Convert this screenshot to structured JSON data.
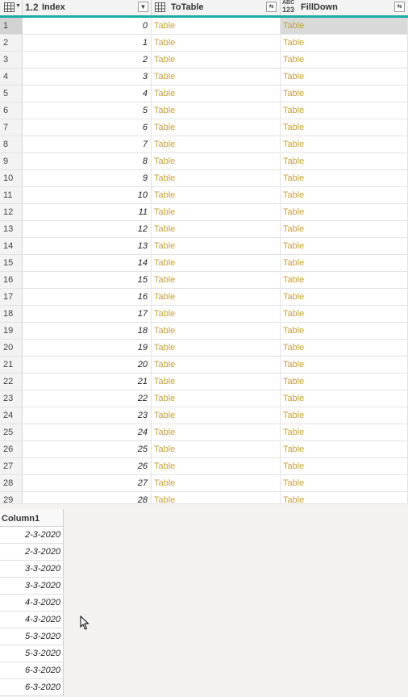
{
  "columns": [
    {
      "type_icon": "table-icon",
      "name": ""
    },
    {
      "type_icon": "1.2",
      "name": "Index"
    },
    {
      "type_icon": "table-icon",
      "name": "ToTable"
    },
    {
      "type_icon": "ABC 123",
      "name": "FillDown"
    }
  ],
  "type_abc": "ABC",
  "type_123": "123",
  "table_link": "Table",
  "row_numbers": [
    "1",
    "2",
    "3",
    "4",
    "5",
    "6",
    "7",
    "8",
    "9",
    "10",
    "11",
    "12",
    "13",
    "14",
    "15",
    "16",
    "17",
    "18",
    "19",
    "20",
    "21",
    "22",
    "23",
    "24",
    "25",
    "26",
    "27",
    "28",
    "29"
  ],
  "index_values": [
    "0",
    "1",
    "2",
    "3",
    "4",
    "5",
    "6",
    "7",
    "8",
    "9",
    "10",
    "11",
    "12",
    "13",
    "14",
    "15",
    "16",
    "17",
    "18",
    "19",
    "20",
    "21",
    "22",
    "23",
    "24",
    "25",
    "26",
    "27",
    "28"
  ],
  "selected_row": 1,
  "preview": {
    "header": "Column1",
    "values": [
      "2-3-2020",
      "2-3-2020",
      "3-3-2020",
      "3-3-2020",
      "4-3-2020",
      "4-3-2020",
      "5-3-2020",
      "5-3-2020",
      "6-3-2020",
      "6-3-2020"
    ]
  },
  "accent_color": "#1aaba4",
  "link_color": "#c8a23a"
}
